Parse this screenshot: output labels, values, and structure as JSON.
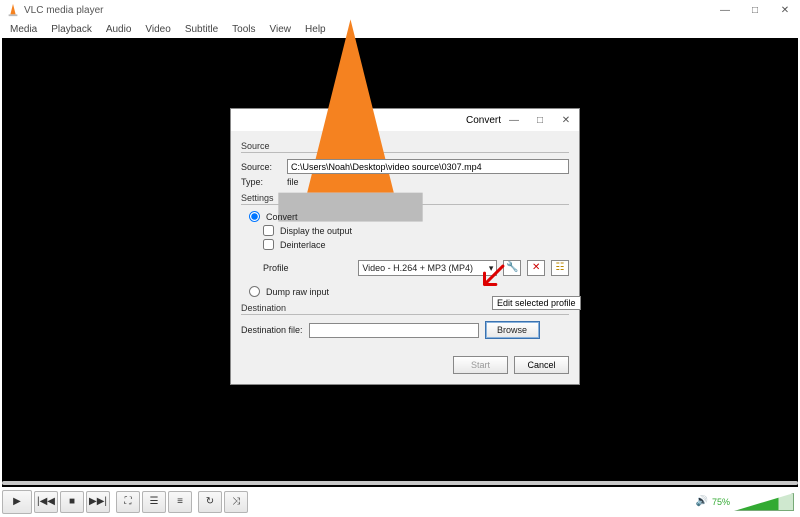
{
  "app": {
    "title": "VLC media player",
    "menu": [
      "Media",
      "Playback",
      "Audio",
      "Video",
      "Subtitle",
      "Tools",
      "View",
      "Help"
    ]
  },
  "controls": {
    "play": "▶",
    "prev": "|◀◀",
    "stop": "■",
    "next": "▶▶|",
    "fullscreen": "⛶",
    "extended": "☰",
    "playlist": "≡",
    "loop": "↻",
    "shuffle": "⤨",
    "volume_pct": "75%",
    "speaker": "🔊"
  },
  "dialog": {
    "title": "Convert",
    "source_hdr": "Source",
    "source_label": "Source:",
    "source_value": "C:\\Users\\Noah\\Desktop\\video source\\0307.mp4",
    "type_label": "Type:",
    "type_value": "file",
    "settings_hdr": "Settings",
    "convert_label": "Convert",
    "display_output": "Display the output",
    "deinterlace": "Deinterlace",
    "profile_label": "Profile",
    "profile_value": "Video - H.264 + MP3 (MP4)",
    "dump_label": "Dump raw input",
    "destination_hdr": "Destination",
    "dest_file_label": "Destination file:",
    "dest_value": "",
    "browse": "Browse",
    "start": "Start",
    "cancel": "Cancel",
    "edit_profile_tooltip": "Edit selected profile",
    "icon_wrench": "🔧",
    "icon_delete": "✕",
    "icon_new": "☷",
    "select_caret": "▾"
  },
  "win": {
    "min": "—",
    "max": "□",
    "close": "✕"
  }
}
